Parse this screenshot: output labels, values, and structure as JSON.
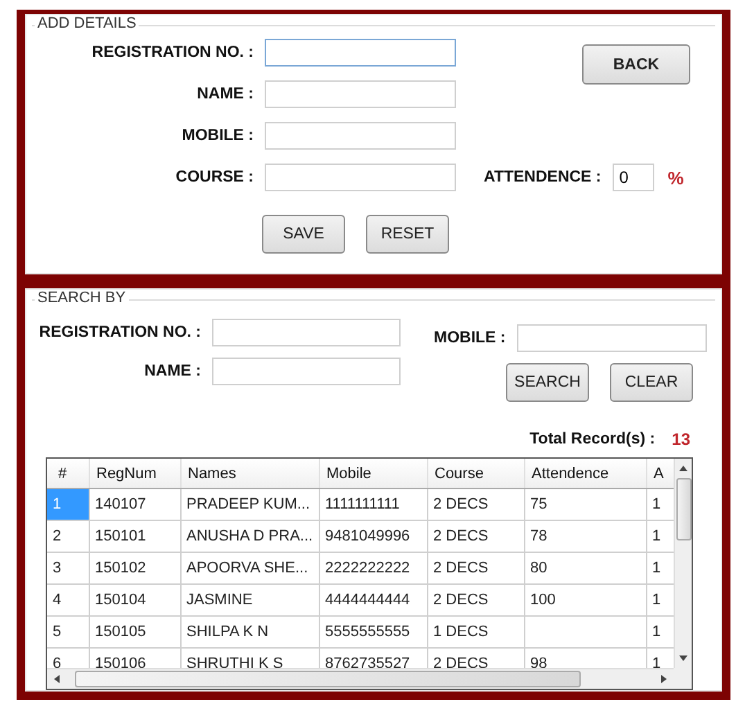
{
  "add_details": {
    "legend": "ADD DETAILS",
    "fields": [
      {
        "label": "REGISTRATION NO. :",
        "focused": true
      },
      {
        "label": "NAME :",
        "focused": false
      },
      {
        "label": "MOBILE :",
        "focused": false
      },
      {
        "label": "COURSE :",
        "focused": false
      }
    ],
    "back_button": "BACK",
    "attendance": {
      "label": "ATTENDENCE :",
      "value": "0",
      "unit": "%"
    },
    "buttons": [
      "SAVE",
      "RESET"
    ]
  },
  "search_by": {
    "legend": "SEARCH BY",
    "registration": {
      "label": "REGISTRATION NO. :"
    },
    "name": {
      "label": "NAME :"
    },
    "mobile": {
      "label": "MOBILE :"
    },
    "buttons": [
      "SEARCH",
      "CLEAR"
    ],
    "total": {
      "label": "Total Record(s) :",
      "value": "13"
    }
  },
  "table": {
    "columns": [
      "#",
      "RegNum",
      "Names",
      "Mobile",
      "Course",
      "Attendence",
      "A"
    ],
    "rows": [
      {
        "selected": true,
        "cells": [
          "1",
          "140107",
          "PRADEEP KUM...",
          "1111111111",
          "2 DECS",
          "75",
          "1"
        ]
      },
      {
        "selected": false,
        "cells": [
          "2",
          "150101",
          "ANUSHA D PRA...",
          "9481049996",
          "2 DECS",
          "78",
          "1"
        ]
      },
      {
        "selected": false,
        "cells": [
          "3",
          "150102",
          "APOORVA SHE...",
          "2222222222",
          "2 DECS",
          "80",
          "1"
        ]
      },
      {
        "selected": false,
        "cells": [
          "4",
          "150104",
          "JASMINE",
          "4444444444",
          "2 DECS",
          "100",
          "1"
        ]
      },
      {
        "selected": false,
        "cells": [
          "5",
          "150105",
          "SHILPA K N",
          "5555555555",
          "1 DECS",
          "",
          "1"
        ]
      },
      {
        "selected": false,
        "cells": [
          "6",
          "150106",
          "SHRUTHI K S",
          "8762735527",
          "2 DECS",
          "98",
          "1"
        ]
      }
    ]
  }
}
